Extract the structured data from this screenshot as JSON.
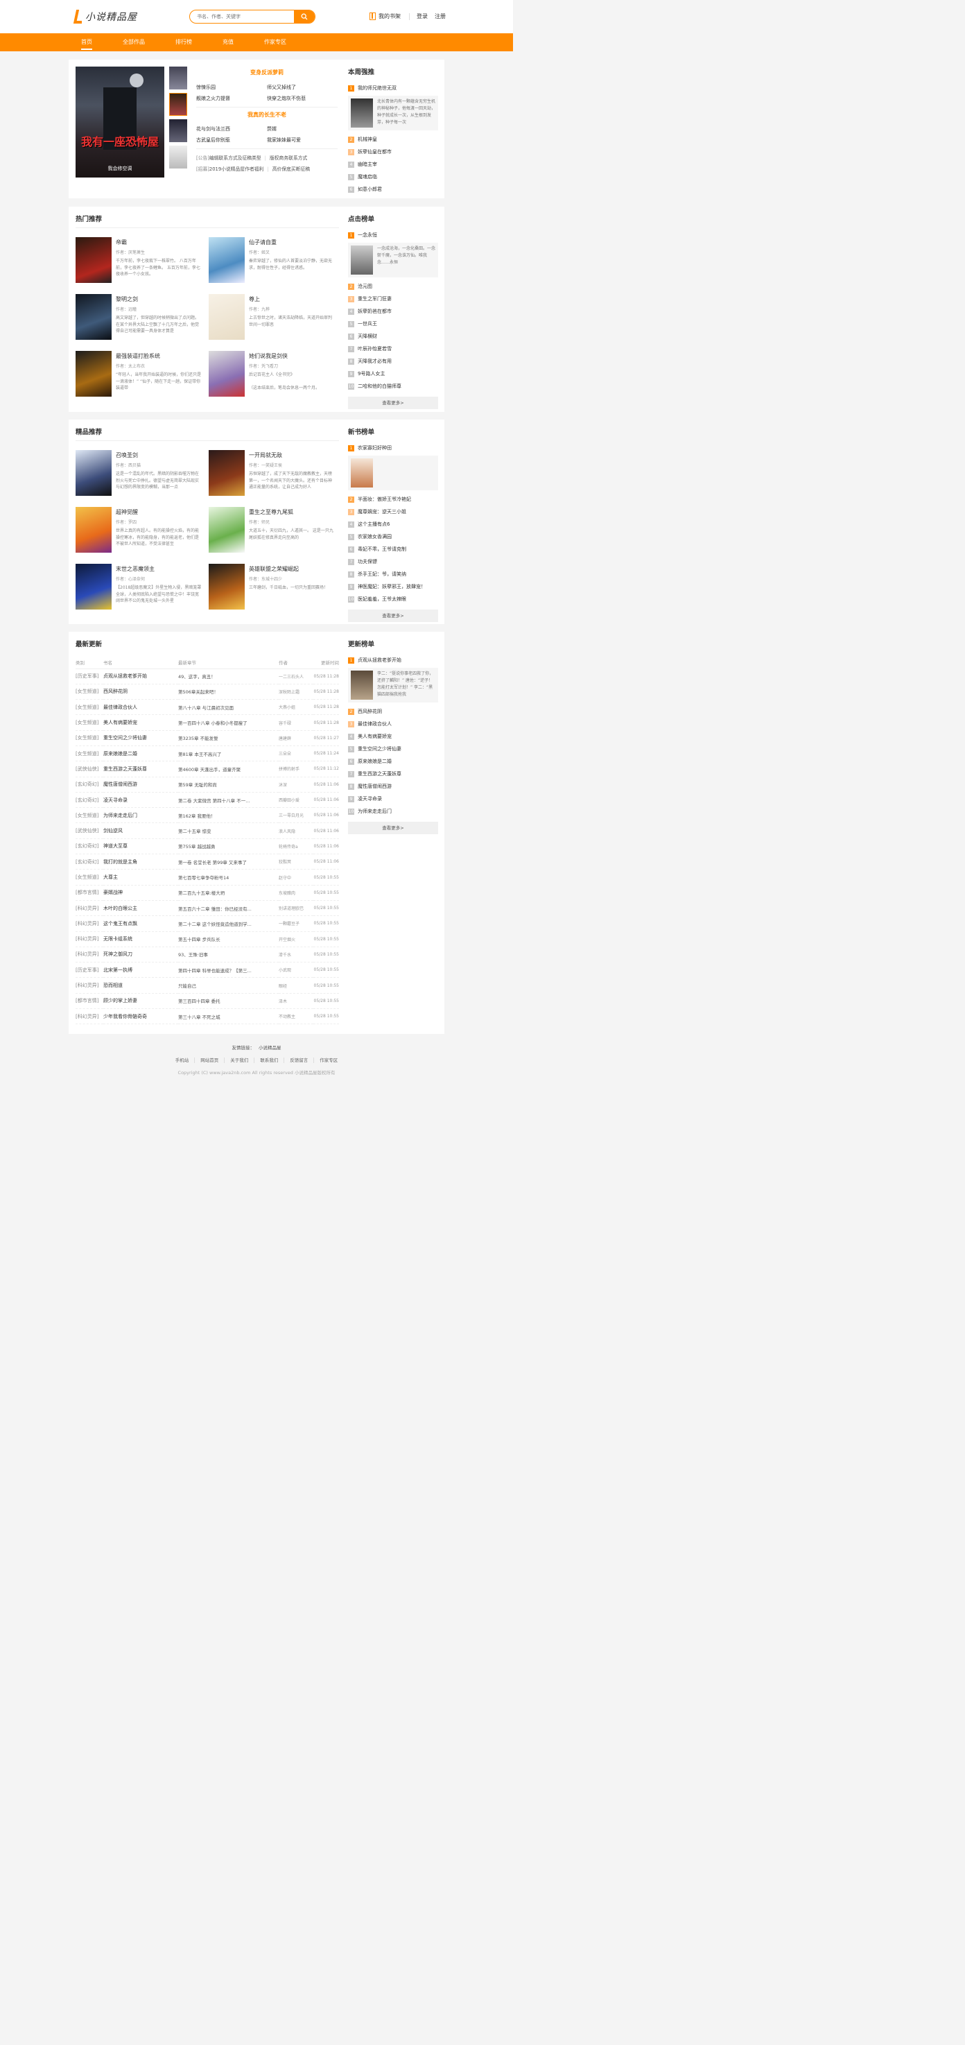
{
  "header": {
    "logo_text": "小说精品屋",
    "search_placeholder": "书名、作者、关键字",
    "shelf_label": "我的书架",
    "login": "登录",
    "register": "注册"
  },
  "nav": [
    "首页",
    "全部作品",
    "排行榜",
    "充值",
    "作家专区"
  ],
  "featured": {
    "cover_title": "我有一座恐怖屋",
    "cover_author": "我会修空调",
    "group1_title": "变身反派萝莉",
    "group1_links": [
      "惊悚乐园",
      "师父又掉线了",
      "舰娘之火力提督",
      "快穿之炮灰不伤悲"
    ],
    "group2_title": "我真的长生不老",
    "group2_links": [
      "花与剑与法兰西",
      "赘婿",
      "古武皇后你别惹",
      "我家妹妹最可爱"
    ],
    "notices": [
      {
        "tag": "[公告]",
        "a": "编辑联系方式及征稿类型",
        "b": "版权商务联系方式"
      },
      {
        "tag": "[招募]",
        "a": "2019小说精品屋作者福利",
        "b": "高价保底买断征稿"
      }
    ]
  },
  "weekly": {
    "title": "本周强推",
    "items": [
      "我的师兄绝世无双",
      "机械神皇",
      "妖孽仙皇在都市",
      "幽暗主宰",
      "魔魂启临",
      "如意小郎君"
    ],
    "detail": "北长青体内有一颗蕴含无穷生机的神秘种子，他每渡一回天劫，种子就成长一次，从生根到发芽，种子每一次"
  },
  "hot": {
    "title": "热门推荐",
    "books": [
      {
        "title": "帝霸",
        "author": "作者：厌笔萧生",
        "desc": "千万年前，李七夜栽下一株翠竹。 八百万年前，李七夜养了一条鲤鱼。 五百万年前，李七夜收养一个小女孩。"
      },
      {
        "title": "仙子请自重",
        "author": "作者：姬叉",
        "desc": "秦弈穿越了，修仙的人首要淡泊宁静，无欲无求，耐得住性子，经得住诱惑。"
      },
      {
        "title": "黎明之剑",
        "author": "作者：远瞳",
        "desc": "高文穿越了，但穿越的时候稍微出了点问题。在某个异界大陆上空飘了十几万年之后，他觉得自己可能需要一具身体才算是"
      },
      {
        "title": "尊上",
        "author": "作者：九桦",
        "desc": "上古惊世之时，诸天浩劫降临，天道开始审判世间一切罪恶"
      },
      {
        "title": "最强装逼打脸系统",
        "author": "作者：太上布衣",
        "desc": "“年轻人，当年我开始装逼的时候，你们还只是一滴液体！” “仙子，随在下走一趟，保证带你装逼带"
      },
      {
        "title": "她们说我是剑侠",
        "author": "作者：凭飞看刀",
        "desc": "后记百花主人《全书完》"
      }
    ]
  },
  "hot_books_extra": [
    "（这本结束后，笔岛会休息一两个月。"
  ],
  "click_rank": {
    "title": "点击榜单",
    "items": [
      "一念永恒",
      "沧元图",
      "重生之军门狂妻",
      "妖孽奶爸在都市",
      "一世兵王",
      "天降横财",
      "叶辰孙怡夏若雪",
      "天降我才必有用",
      "9号路人女主",
      "二哈和他的白猫师尊"
    ],
    "detail": "一念成沧海，一念化桑田。一念斩千魔，一念诛万仙。唯我念……永恒",
    "more": "查看更多>"
  },
  "quality": {
    "title": "精品推荐",
    "books": [
      {
        "title": "召唤圣剑",
        "author": "作者：西贝猫",
        "desc": "这是一个混乱的年代。黑暗的阴影吞噬万物在烈火与死亡中挣扎。德望与虚无简翠大陆现实与幻想的界限变的模糊，当那一点"
      },
      {
        "title": "一开局就无敌",
        "author": "作者：一笑疑王侯",
        "desc": "苏恒穿越了，成了天下无敌的魔教教主，天榜第一，一个名闻天下的大魔头。还有个目标神通正能量的系统，让自己成为好人"
      },
      {
        "title": "超神觉醒",
        "author": "作者：罗四",
        "desc": "世界上真的有超人。有的能操控火焰，有的能操控寒冰，有的能隐身，有的能返老，他们是不被世人所知道，不受法律甚至"
      },
      {
        "title": "重生之至尊九尾狐",
        "author": "作者：师兄",
        "desc": "大道五十，天衍四九，人遁其一。 这是一只九尾妖狐在修真界走向至高的"
      },
      {
        "title": "末世之恶魔领主",
        "author": "作者：心泽奈何",
        "desc": "【2018超级恶魔文】外星生物入侵，黑暗笼罩全球，人类彻底陷入绝望与恐慌之中！丰饶宽阔世界不公的鬼无处城一头外星"
      },
      {
        "title": "英雄联盟之荣耀崛起",
        "author": "作者：东城十四少",
        "desc": "三年磨剑，千日砥血，一切只为重回赛场！"
      }
    ]
  },
  "new_rank": {
    "title": "新书榜单",
    "items": [
      "农家寡妇好种田",
      "半面妆：傲娇王爷冷艳妃",
      "魔尊嫡宠：逆天三小姐",
      "这个主播有点6",
      "农家娘女香满园",
      "毒妃不乖，王爷请克制",
      "功夫保镖",
      "杀手王妃：爷，请笑纳",
      "神医魔妃：妖孽邪王，放肆宠！",
      "医妃羞羞，王爷太辣眼"
    ],
    "more": "查看更多>"
  },
  "updates": {
    "title": "最新更新",
    "columns": [
      "类别",
      "书名",
      "最新章节",
      "作者",
      "更新时间"
    ],
    "rows": [
      [
        "[历史军事]",
        "贞观从拯救老爹开始",
        "49、这字，真丑！",
        "一二三石头人",
        "05/28 11:28"
      ],
      [
        "[女生频道]",
        "西风醉花阴",
        "第506章关起来吧！",
        "深秋陌上霜",
        "05/28 11:28"
      ],
      [
        "[女生频道]",
        "最佳律政合伙人",
        "第八十八章 与江晨初次见面",
        "大燕小姐",
        "05/28 11:28"
      ],
      [
        "[女生频道]",
        "美人有病要娇宠",
        "第一百四十八章 小春和小冬都瘦了",
        "容千碌",
        "05/28 11:28"
      ],
      [
        "[女生频道]",
        "重生空间之少将仙妻",
        "第3235章 不能发誓",
        "唐建薛",
        "05/28 11:27"
      ],
      [
        "[女生频道]",
        "原来娘娘是二婚",
        "第81章 本王不高兴了",
        "三朵朵",
        "05/28 11:24"
      ],
      [
        "[武侠仙侠]",
        "重生西游之天蓬妖尊",
        "第4600章 天蓬出手，道童齐聚",
        "拼搏的射手",
        "05/28 11:12"
      ],
      [
        "[玄幻奇幻]",
        "魔性唐僧闹西游",
        "第59章 无耻的和尚",
        "沐深",
        "05/28 11:06"
      ],
      [
        "[玄幻奇幻]",
        "凌天寻命录",
        "第二卷 大紫微宫 第四十八章 不一...",
        "西瓣田小爱",
        "05/28 11:06"
      ],
      [
        "[女生频道]",
        "为师来走走后门",
        "第162章 我要他！",
        "三一零白月光",
        "05/28 11:06"
      ],
      [
        "[武侠仙侠]",
        "剑仙逆风",
        "第二十五章 惊变",
        "浪人风隐",
        "05/28 11:06"
      ],
      [
        "[玄幻奇幻]",
        "神道大至尊",
        "第755章 越战越勇",
        "轮椅传奇a",
        "05/28 11:06"
      ],
      [
        "[玄幻奇幻]",
        "我打的就是主角",
        "第一卷 名堂长老 第99章 又来事了",
        "狡黠冥",
        "05/28 11:06"
      ],
      [
        "[女生频道]",
        "大尊主",
        "第七百零七章争夺粉号14",
        "赵守中",
        "05/28 10:55"
      ],
      [
        "[都市言情]",
        "豪婿战神",
        "第二百九十五章:楼大坍",
        "东坡醋肉",
        "05/28 10:55"
      ],
      [
        "[科幻灵异]",
        "木叶的白眼公主",
        "第五百六十二章 雏田：你已经没有...",
        "别讲道理欧巴",
        "05/28 10:55"
      ],
      [
        "[科幻灵异]",
        "这个鬼王有点飘",
        "第二十二章 这个妖怪竟造他道到学...",
        "一颗蘑豆子",
        "05/28 10:55"
      ],
      [
        "[科幻灵异]",
        "无限卡组系统",
        "第五十四章 步兵队长",
        "开空烟火",
        "05/28 10:55"
      ],
      [
        "[科幻灵异]",
        "死神之御风刀",
        "93、王殊·旧事",
        "漆千水",
        "05/28 10:55"
      ],
      [
        "[历史军事]",
        "北宋第一执缚",
        "第四十四章 科举也能速成？【第三...",
        "小武观",
        "05/28 10:55"
      ],
      [
        "[科幻灵异]",
        "恐而相道",
        "只能自己",
        "眼经",
        "05/28 10:55"
      ],
      [
        "[都市言情]",
        "顾少的掌上娇妻",
        "第三百四十四章 委托",
        "泽木",
        "05/28 10:55"
      ],
      [
        "[科幻灵异]",
        "少年我看你骨骼奇奇",
        "第三十八章 不死之城",
        "不动教主",
        "05/28 10:55"
      ]
    ]
  },
  "update_rank": {
    "title": "更新榜单",
    "items": [
      "贞观从拯救老爹开始",
      "西风醉花阴",
      "最佳律政合伙人",
      "美人有病要娇宠",
      "重生空间之少将仙妻",
      "原来娘娘是二婚",
      "重生西游之天蓬妖尊",
      "魔性唐僧闹西游",
      "凌天寻命录",
      "为师来走走后门"
    ],
    "detail": "李二：“挺说你事老四救了你，还挤了麟阳！” 唐佐：“逆子！怎能打太军计划！” 李二：“黑猫四部揣我抢我",
    "more": "查看更多>"
  },
  "footer": {
    "friend_label": "友情链接：",
    "friend_link": "小说精品屋",
    "links": [
      "手机站",
      "网站首页",
      "关于我们",
      "联系我们",
      "反馈留言",
      "作家专区"
    ],
    "copyright": "Copyright (C) www.java2nb.com All rights reserved  小说精品屋版权所有"
  }
}
